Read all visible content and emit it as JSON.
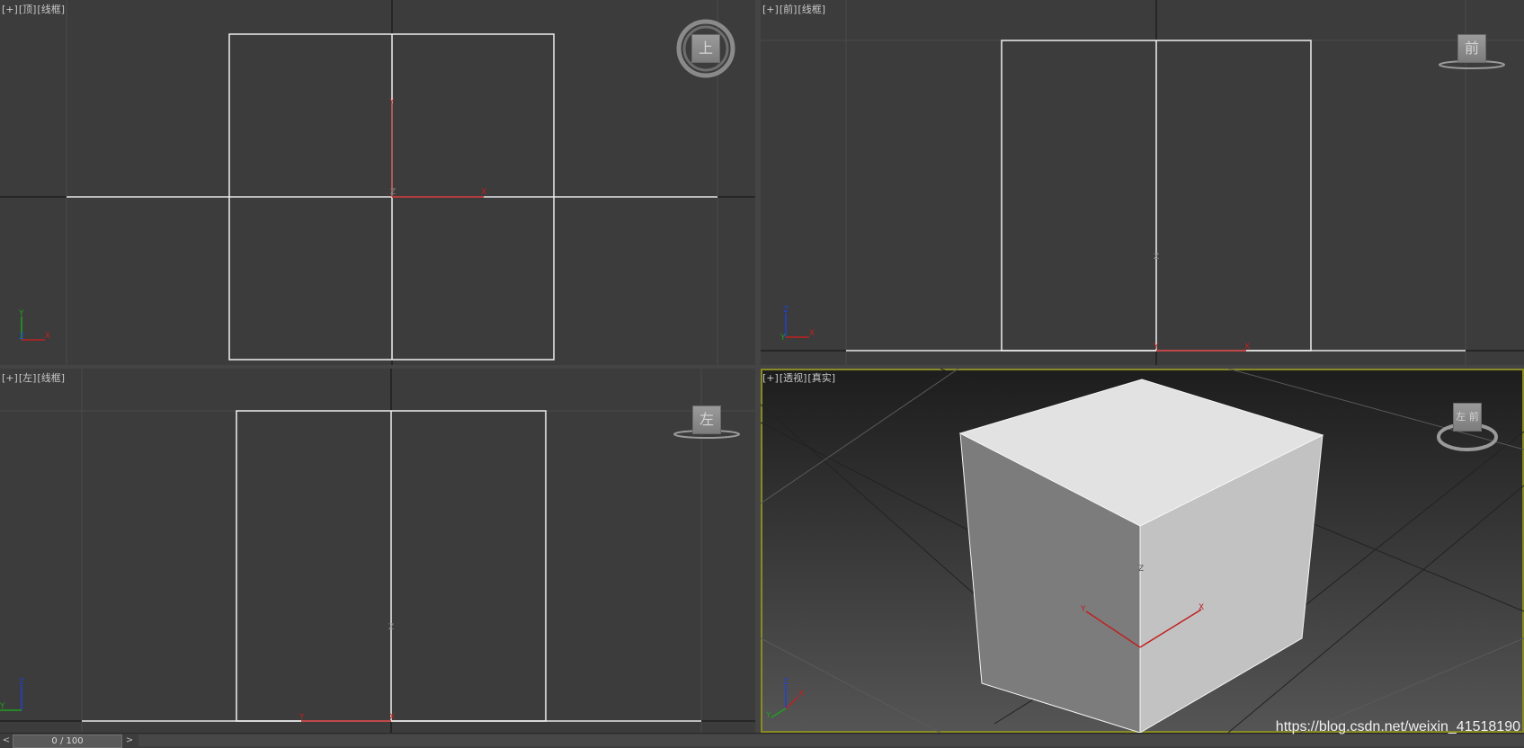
{
  "viewports": {
    "top": {
      "plus": "[+]",
      "view": "[顶]",
      "mode": "[线框]",
      "nav_label": "上",
      "gizmo": {
        "y": "Y",
        "x": "X",
        "z": "Z"
      }
    },
    "front": {
      "plus": "[+]",
      "view": "[前]",
      "mode": "[线框]",
      "nav_label": "前",
      "gizmo": {
        "y": "Y",
        "x": "X",
        "z": "Z"
      }
    },
    "left": {
      "plus": "[+]",
      "view": "[左]",
      "mode": "[线框]",
      "nav_label": "左",
      "gizmo": {
        "y": "Y",
        "x": "X",
        "z": "Z"
      }
    },
    "perspective": {
      "plus": "[+]",
      "view": "[透视]",
      "mode": "[真实]",
      "nav_label": "左 前",
      "gizmo": {
        "y": "Y",
        "x": "X",
        "z": "Z"
      }
    }
  },
  "timeline": {
    "prev": "<",
    "next": ">",
    "frame": "0 / 100"
  },
  "watermark": "https://blog.csdn.net/weixin_41518190",
  "colors": {
    "viewport_bg": "#3c3c3c",
    "active_border": "#8a8a25",
    "x_axis": "#c02020",
    "y_axis": "#20a020",
    "z_axis": "#2040d0"
  }
}
